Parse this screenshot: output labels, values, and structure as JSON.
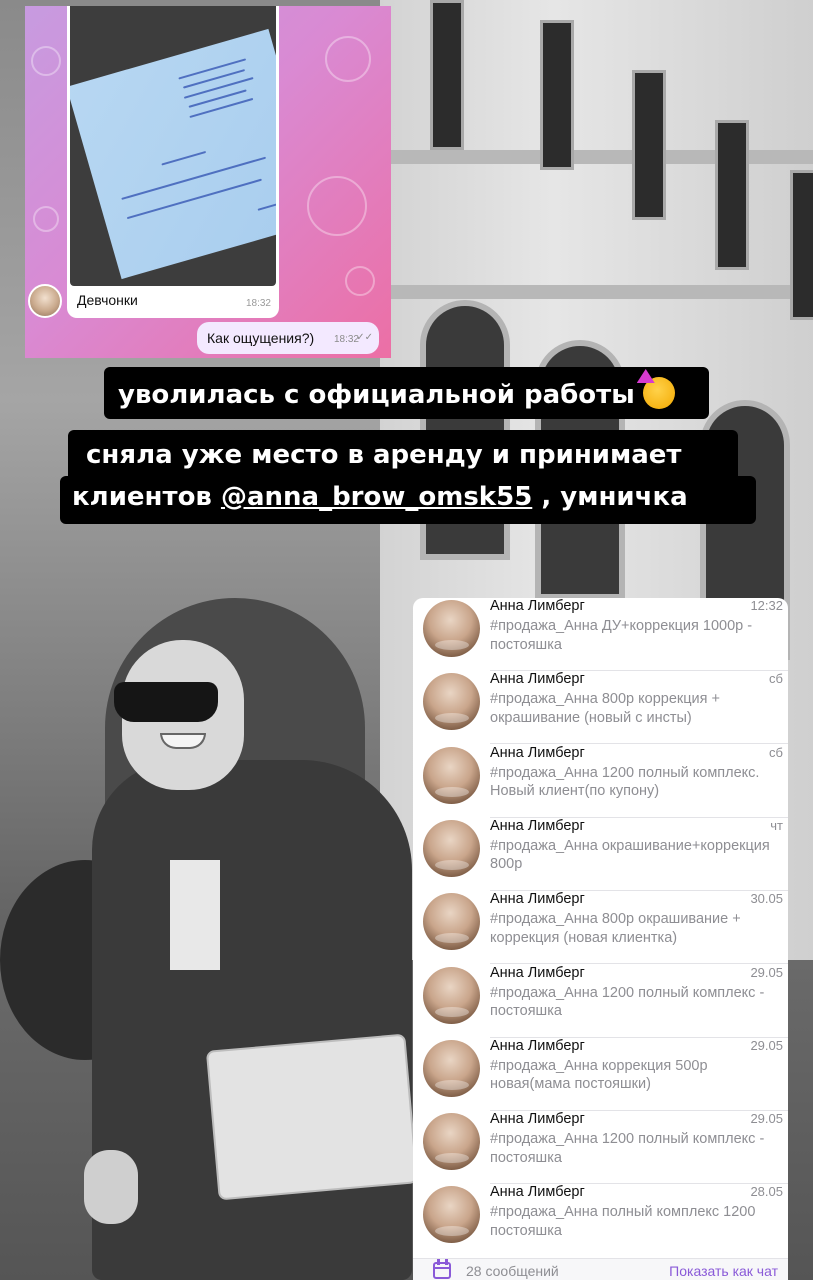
{
  "chat_screenshot": {
    "photo_caption": "Девчонки",
    "photo_time": "18:32",
    "outgoing_text": "Как ощущения?)",
    "outgoing_time": "18:32"
  },
  "captions": {
    "line1": "уволилась с официальной работы",
    "line1_emoji": "partying-face-emoji",
    "line2": "сняла уже место в аренду и принимает",
    "line3_prefix": "клиентов ",
    "line3_mention": "@anna_brow_omsk55",
    "line3_suffix": " , умничка"
  },
  "chat_list": {
    "items": [
      {
        "name": "Анна Лимберг",
        "time": "12:32",
        "message": "#продажа_Анна ДУ+коррекция 1000р - постояшка"
      },
      {
        "name": "Анна Лимберг",
        "time": "сб",
        "message": "#продажа_Анна 800р коррекция + окрашивание (новый с инсты)"
      },
      {
        "name": "Анна Лимберг",
        "time": "сб",
        "message": "#продажа_Анна 1200 полный комплекс. Новый клиент(по купону)"
      },
      {
        "name": "Анна Лимберг",
        "time": "чт",
        "message": "#продажа_Анна окрашивание+коррекция 800р"
      },
      {
        "name": "Анна Лимберг",
        "time": "30.05",
        "message": "#продажа_Анна 800р окрашивание + коррекция (новая клиентка)"
      },
      {
        "name": "Анна Лимберг",
        "time": "29.05",
        "message": "#продажа_Анна 1200 полный комплекс - постояшка"
      },
      {
        "name": "Анна Лимберг",
        "time": "29.05",
        "message": "#продажа_Анна коррекция 500р новая(мама постояшки)"
      },
      {
        "name": "Анна Лимберг",
        "time": "29.05",
        "message": "#продажа_Анна 1200 полный комплекс - постояшка"
      },
      {
        "name": "Анна Лимберг",
        "time": "28.05",
        "message": "#продажа_Анна полный комплекс 1200 постояшка"
      }
    ],
    "footer_icon": "calendar-icon",
    "footer_count": "28 сообщений",
    "footer_link": "Показать как чат"
  },
  "colors": {
    "accent": "#8a5ad8",
    "caption_bg": "#000000",
    "chat_gradient_start": "#c79be0",
    "chat_gradient_end": "#ec6fa5"
  }
}
